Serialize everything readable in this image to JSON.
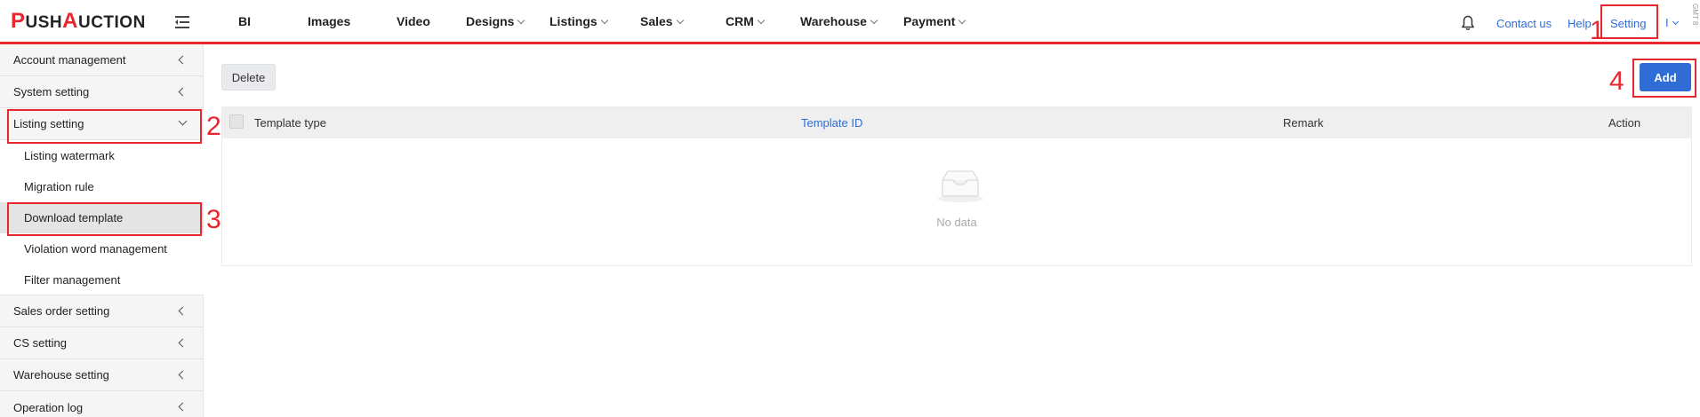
{
  "app": {
    "logo_parts": [
      "P",
      "USH",
      "A",
      "UCTION"
    ]
  },
  "nav": {
    "items": [
      {
        "label": "BI",
        "has_caret": false
      },
      {
        "label": "Images",
        "has_caret": false
      },
      {
        "label": "Video",
        "has_caret": false
      },
      {
        "label": "Designs",
        "has_caret": true
      },
      {
        "label": "Listings",
        "has_caret": true
      },
      {
        "label": "Sales",
        "has_caret": true
      },
      {
        "label": "CRM",
        "has_caret": true
      },
      {
        "label": "Warehouse",
        "has_caret": true
      },
      {
        "label": "Payment",
        "has_caret": true
      }
    ],
    "contact_label": "Contact us",
    "help_label": "Help",
    "setting_label": "Setting",
    "user_label": "I",
    "side_note": "GMT 8"
  },
  "sidebar": {
    "items": [
      {
        "label": "Account management",
        "expanded": false
      },
      {
        "label": "System setting",
        "expanded": false
      },
      {
        "label": "Listing setting",
        "expanded": true
      }
    ],
    "subitems": [
      {
        "label": "Listing watermark",
        "active": false
      },
      {
        "label": "Migration rule",
        "active": false
      },
      {
        "label": "Download template",
        "active": true
      },
      {
        "label": "Violation word management",
        "active": false
      },
      {
        "label": "Filter management",
        "active": false
      }
    ],
    "items_after": [
      {
        "label": "Sales order setting"
      },
      {
        "label": "CS setting"
      },
      {
        "label": "Warehouse setting"
      },
      {
        "label": "Operation log"
      }
    ]
  },
  "main": {
    "delete_label": "Delete",
    "add_label": "Add",
    "columns": [
      "Template type",
      "Template ID",
      "Remark",
      "Action"
    ],
    "empty_text": "No data"
  },
  "annotations": [
    "1",
    "2",
    "3",
    "4"
  ],
  "colors": {
    "accent": "#2f6cd6",
    "brand_red": "#e8262d"
  }
}
